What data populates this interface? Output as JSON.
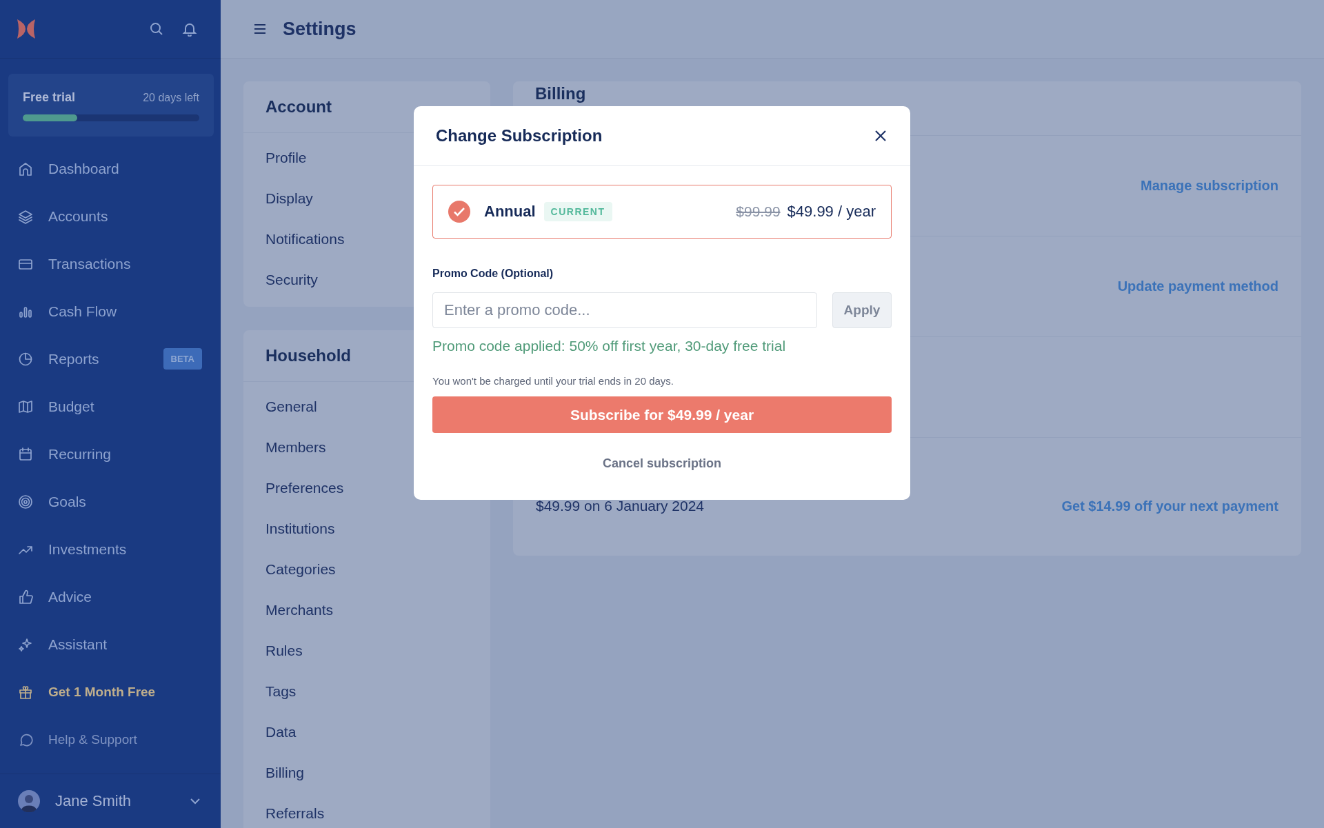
{
  "sidebar": {
    "trial": {
      "label": "Free trial",
      "remaining": "20 days left",
      "level": 0.31
    },
    "nav": [
      {
        "label": "Dashboard",
        "kind": "nav"
      },
      {
        "label": "Accounts",
        "kind": "nav"
      },
      {
        "label": "Transactions",
        "kind": "nav"
      },
      {
        "label": "Cash Flow",
        "kind": "nav"
      },
      {
        "label": "Reports",
        "kind": "nav",
        "badge": "BETA"
      },
      {
        "label": "Budget",
        "kind": "nav"
      },
      {
        "label": "Recurring",
        "kind": "nav"
      },
      {
        "label": "Goals",
        "kind": "nav"
      },
      {
        "label": "Investments",
        "kind": "nav"
      },
      {
        "label": "Advice",
        "kind": "nav"
      },
      {
        "label": "Assistant",
        "kind": "nav"
      },
      {
        "label": "Get 1 Month Free",
        "kind": "promo"
      },
      {
        "label": "Help & Support",
        "kind": "help"
      }
    ],
    "user": {
      "name": "Jane Smith"
    }
  },
  "header": {
    "title": "Settings"
  },
  "settings_nav": [
    {
      "title": "Account",
      "items": [
        "Profile",
        "Display",
        "Notifications",
        "Security"
      ]
    },
    {
      "title": "Household",
      "items": [
        "General",
        "Members",
        "Preferences",
        "Institutions",
        "Categories",
        "Merchants",
        "Rules",
        "Tags",
        "Data",
        "Billing",
        "Referrals"
      ]
    }
  ],
  "billing": {
    "title": "Billing",
    "rows": [
      {
        "link": "Manage subscription"
      },
      {
        "link": "Update payment method"
      },
      {},
      {
        "text": "$49.99 on 6 January 2024",
        "link": "Get $14.99 off your next payment"
      }
    ]
  },
  "modal": {
    "title": "Change Subscription",
    "plan": {
      "name": "Annual",
      "badge": "CURRENT",
      "old_price": "$99.99",
      "price": "$49.99 / year",
      "selected": true
    },
    "promo": {
      "label": "Promo Code (Optional)",
      "placeholder": "Enter a promo code...",
      "button": "Apply"
    },
    "promo_message": "Promo code applied: 50% off first year, 30-day free trial",
    "note": "You won't be charged until your trial ends in 20 days.",
    "subscribe_button": "Subscribe for $49.99 / year",
    "cancel_link": "Cancel subscription"
  }
}
